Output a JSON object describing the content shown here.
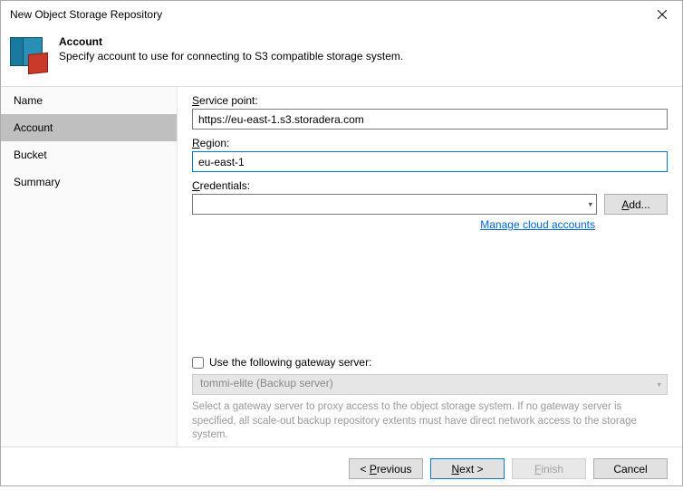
{
  "window": {
    "title": "New Object Storage Repository"
  },
  "header": {
    "title": "Account",
    "subtitle": "Specify account to use for connecting to S3 compatible storage system."
  },
  "sidebar": {
    "items": [
      {
        "label": "Name",
        "active": false
      },
      {
        "label": "Account",
        "active": true
      },
      {
        "label": "Bucket",
        "active": false
      },
      {
        "label": "Summary",
        "active": false
      }
    ]
  },
  "form": {
    "service_point_label_pre": "S",
    "service_point_label_rest": "ervice point:",
    "service_point_value": "https://eu-east-1.s3.storadera.com",
    "region_label_pre": "R",
    "region_label_rest": "egion:",
    "region_value": "eu-east-1",
    "credentials_label_pre": "C",
    "credentials_label_rest": "redentials:",
    "credentials_value": "",
    "add_btn_pre": "A",
    "add_btn_rest": "dd...",
    "manage_link": "Manage cloud accounts"
  },
  "gateway": {
    "checkbox_label": "Use the following gateway server:",
    "server": "tommi-elite (Backup server)",
    "hint": "Select a gateway server to proxy access to the object storage system. If no gateway server is specified, all scale-out backup repository extents must have direct network access to the storage system.",
    "checked": false
  },
  "footer": {
    "previous_pre": "< ",
    "previous_ul": "P",
    "previous_rest": "revious",
    "next_ul": "N",
    "next_rest": "ext >",
    "finish_ul": "F",
    "finish_rest": "inish",
    "cancel": "Cancel"
  }
}
